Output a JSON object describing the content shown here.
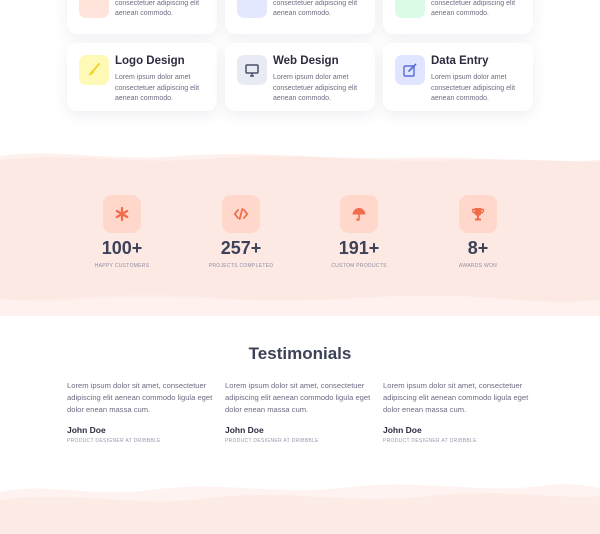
{
  "services_top": [
    {
      "text": "Lorem ipsum dolor amet consectetuer adipiscing elit aenean commodo.",
      "color": "#ffe4dc"
    },
    {
      "text": "Lorem ipsum dolor amet consectetuer adipiscing elit aenean commodo.",
      "color": "#e4e8ff"
    },
    {
      "text": "Lorem ipsum dolor amet consectetuer adipiscing elit aenean commodo.",
      "color": "#dcfbe6"
    }
  ],
  "services": [
    {
      "title": "Logo Design",
      "text": "Lorem ipsum dolor amet consectetuer adipiscing elit aenean commodo.",
      "icon": "brush-icon",
      "color": "#fff9b8"
    },
    {
      "title": "Web Design",
      "text": "Lorem ipsum dolor amet consectetuer adipiscing elit aenean commodo.",
      "icon": "monitor-icon",
      "color": "#e8eaf4"
    },
    {
      "title": "Data Entry",
      "text": "Lorem ipsum dolor amet consectetuer adipiscing elit aenean commodo.",
      "icon": "edit-icon",
      "color": "#e0e6ff"
    }
  ],
  "stats": [
    {
      "value": "100+",
      "label": "HAPPY CUSTOMERS",
      "icon": "asterisk-icon"
    },
    {
      "value": "257+",
      "label": "PROJECTS COMPLETED",
      "icon": "code-icon"
    },
    {
      "value": "191+",
      "label": "CUSTOM PRODUCTS",
      "icon": "umbrella-icon"
    },
    {
      "value": "8+",
      "label": "AWARDS WON",
      "icon": "trophy-icon"
    }
  ],
  "testimonials": {
    "title": "Testimonials",
    "items": [
      {
        "quote": "Lorem ipsum dolor sit amet, consectetuer adipiscing elit aenean commodo ligula eget dolor enean massa cum.",
        "name": "John Doe",
        "role": "PRODUCT DESIGNER AT DRIBBBLE"
      },
      {
        "quote": "Lorem ipsum dolor sit amet, consectetuer adipiscing elit aenean commodo ligula eget dolor enean massa cum.",
        "name": "John Doe",
        "role": "PRODUCT DESIGNER AT DRIBBBLE"
      },
      {
        "quote": "Lorem ipsum dolor sit amet, consectetuer adipiscing elit aenean commodo ligula eget dolor enean massa cum.",
        "name": "John Doe",
        "role": "PRODUCT DESIGNER AT DRIBBBLE"
      }
    ]
  },
  "colors": {
    "accent": "#f26b4b",
    "band": "#fde9e4",
    "heading": "#3d4258"
  }
}
